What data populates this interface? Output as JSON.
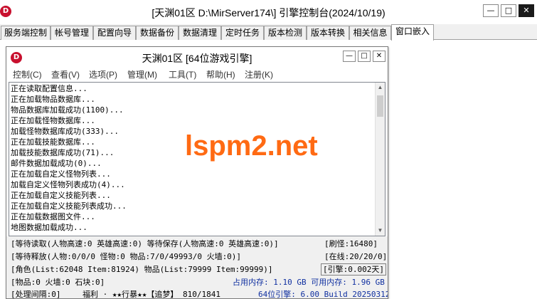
{
  "outer": {
    "title": "[天渊01区 D:\\MirServer174\\] 引擎控制台(2024/10/19)",
    "logo_letter": "D",
    "controls": {
      "minimize": "—",
      "maximize": "□",
      "close": "✕"
    }
  },
  "tabs": [
    {
      "label": "服务端控制"
    },
    {
      "label": "帐号管理"
    },
    {
      "label": "配置向导"
    },
    {
      "label": "数据备份"
    },
    {
      "label": "数据清理"
    },
    {
      "label": "定时任务"
    },
    {
      "label": "版本检测"
    },
    {
      "label": "版本转换"
    },
    {
      "label": "相关信息"
    },
    {
      "label": "窗口嵌入"
    }
  ],
  "inner": {
    "title": "天渊01区 [64位游戏引擎]",
    "logo_letter": "D",
    "controls": {
      "minimize": "—",
      "maximize": "□",
      "close": "✕"
    },
    "menu": [
      {
        "label": "控制(C)"
      },
      {
        "label": "查看(V)"
      },
      {
        "label": "选项(P)"
      },
      {
        "label": "管理(M)"
      },
      {
        "label": "工具(T)"
      },
      {
        "label": "帮助(H)"
      },
      {
        "label": "注册(K)"
      }
    ],
    "log": [
      "正在读取配置信息...",
      "正在加载物品数据库...",
      "物品数据库加载成功(1100)...",
      "正在加载怪物数据库...",
      "加载怪物数据库成功(333)...",
      "正在加载技能数据库...",
      "加载技能数据库成功(71)...",
      "邮件数据加载成功(0)...",
      "正在加载自定义怪物列表...",
      "加载自定义怪物列表成功(4)...",
      "正在加载自定义技能列表...",
      "正在加载自定义技能列表成功...",
      "正在加载数据图文件...",
      "地图数据加载成功..."
    ],
    "status": {
      "line1": "[等待读取(人物高速:0 英雄高速:0) 等待保存(人物高速:0 英雄高速:0)]",
      "refresh": "[刷怪:16480]",
      "line2": "[等待释放(人物:0/0/0 怪物:0 物品:7/0/49993/0 火墙:0)]",
      "online": "[在线:20/20/0]",
      "line3": "[角色(List:62048 Item:81924) 物品(List:79999 Item:99999)]",
      "engine": "[引擎:0.002天]",
      "line4": "[物品:0 火墙:0 石块:0]",
      "memory": "占用内存: 1.10 GB 可用内存: 1.96 GB",
      "line5a": "[处理间隔:0]",
      "line5b": "福利 · ★★行暴★★【追梦】 810/1841",
      "build": "64位引擎: 6.00 Build 20250312"
    }
  },
  "watermark": "lspm2.net",
  "colors": {
    "logo": "#c8102e",
    "watermark": "#ff6a13",
    "status_blue": "#1030a0"
  }
}
